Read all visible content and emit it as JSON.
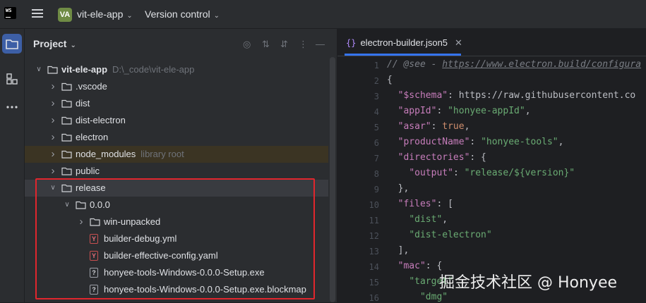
{
  "titlebar": {
    "logo_text": "WS",
    "project_badge": "VA",
    "project_name": "vit-ele-app",
    "version_control": "Version control"
  },
  "project_pane": {
    "title": "Project"
  },
  "tree": [
    {
      "label": "vit-ele-app",
      "hint": "D:\\_code\\vit-ele-app",
      "bold": true,
      "type": "folder",
      "expanded": true,
      "depth": 0
    },
    {
      "label": ".vscode",
      "hint": "",
      "type": "folder",
      "expanded": false,
      "depth": 1
    },
    {
      "label": "dist",
      "hint": "",
      "type": "folder",
      "expanded": false,
      "depth": 1
    },
    {
      "label": "dist-electron",
      "hint": "",
      "type": "folder",
      "expanded": false,
      "depth": 1
    },
    {
      "label": "electron",
      "hint": "",
      "type": "folder",
      "expanded": false,
      "depth": 1
    },
    {
      "label": "node_modules",
      "hint": "library root",
      "type": "folder",
      "expanded": false,
      "depth": 1
    },
    {
      "label": "public",
      "hint": "",
      "type": "folder",
      "expanded": false,
      "depth": 1
    },
    {
      "label": "release",
      "hint": "",
      "type": "folder",
      "expanded": true,
      "depth": 1
    },
    {
      "label": "0.0.0",
      "hint": "",
      "type": "folder",
      "expanded": true,
      "depth": 2
    },
    {
      "label": "win-unpacked",
      "hint": "",
      "type": "folder",
      "expanded": false,
      "depth": 3
    },
    {
      "label": "builder-debug.yml",
      "hint": "",
      "type": "yaml",
      "depth": 3
    },
    {
      "label": "builder-effective-config.yaml",
      "hint": "",
      "type": "yaml",
      "depth": 3
    },
    {
      "label": "honyee-tools-Windows-0.0.0-Setup.exe",
      "hint": "",
      "type": "unknown",
      "depth": 3
    },
    {
      "label": "honyee-tools-Windows-0.0.0-Setup.exe.blockmap",
      "hint": "",
      "type": "unknown",
      "depth": 3
    }
  ],
  "editor": {
    "tab_label": "electron-builder.json5",
    "tab_icon": "{}",
    "line_numbers": [
      "1",
      "2",
      "3",
      "4",
      "5",
      "6",
      "7",
      "8",
      "9",
      "10",
      "11",
      "12",
      "13",
      "14",
      "15",
      "16"
    ],
    "lines": [
      "// @see - https://www.electron.build/configura",
      "{",
      "  \"$schema\": \"https://raw.githubusercontent.co",
      "  \"appId\": \"honyee-appId\",",
      "  \"asar\": true,",
      "  \"productName\": \"honyee-tools\",",
      "  \"directories\": {",
      "    \"output\": \"release/${version}\"",
      "  },",
      "  \"files\": [",
      "    \"dist\",",
      "    \"dist-electron\"",
      "  ],",
      "  \"mac\": {",
      "    \"target\"",
      "      \"dmg\""
    ]
  },
  "watermark": "掘金技术社区 @ Honyee",
  "colors": {
    "highlight_box": "#e0262d",
    "accent": "#3574f0"
  }
}
